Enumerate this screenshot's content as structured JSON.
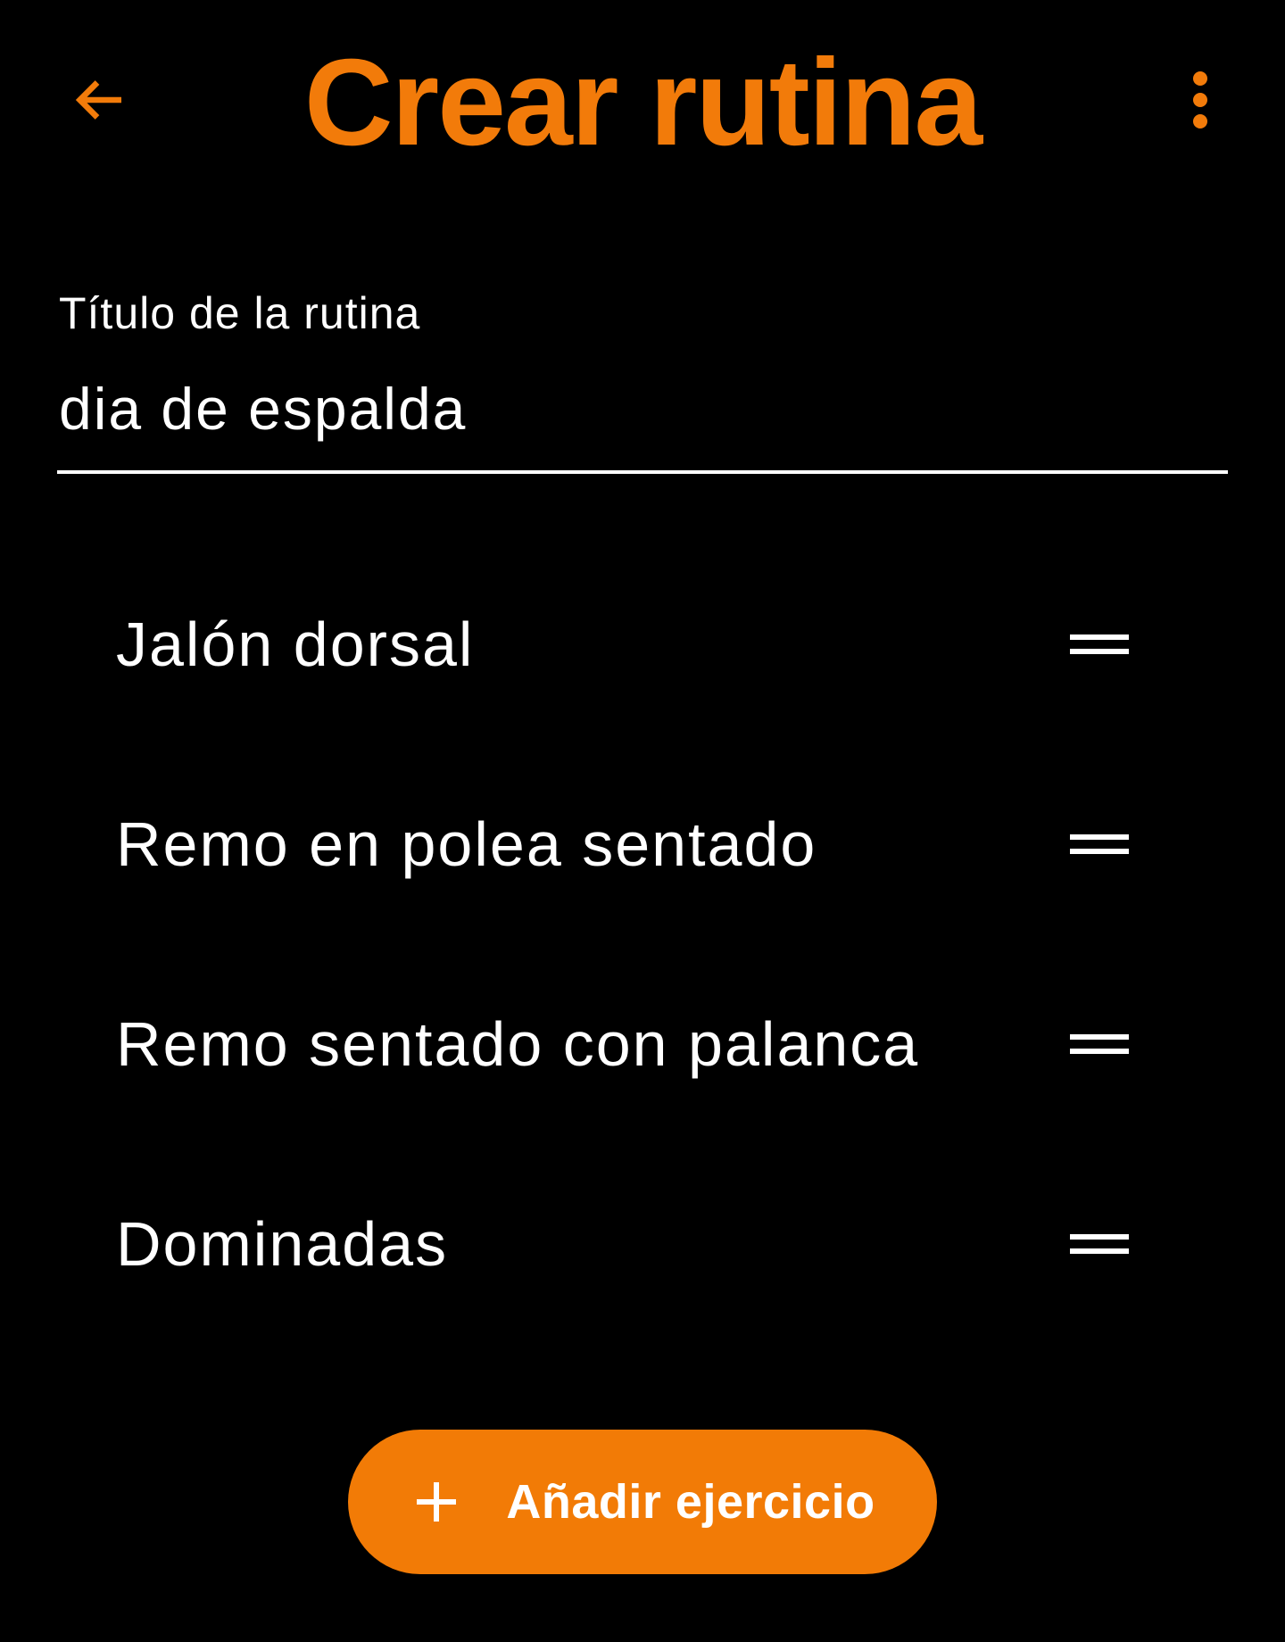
{
  "header": {
    "title": "Crear rutina",
    "back_icon": "arrow-left-icon",
    "menu_icon": "more-vertical-icon"
  },
  "form": {
    "title_label": "Título de la rutina",
    "title_value": "dia de espalda"
  },
  "exercises": [
    {
      "label": "Jalón dorsal",
      "handle_icon": "drag-handle-icon"
    },
    {
      "label": "Remo en polea sentado",
      "handle_icon": "drag-handle-icon"
    },
    {
      "label": "Remo sentado con palanca",
      "handle_icon": "drag-handle-icon"
    },
    {
      "label": "Dominadas",
      "handle_icon": "drag-handle-icon"
    }
  ],
  "add_button": {
    "label": "Añadir ejercicio",
    "icon": "plus-icon"
  },
  "colors": {
    "accent": "#f27b0a",
    "background": "#000000",
    "text": "#ffffff"
  }
}
